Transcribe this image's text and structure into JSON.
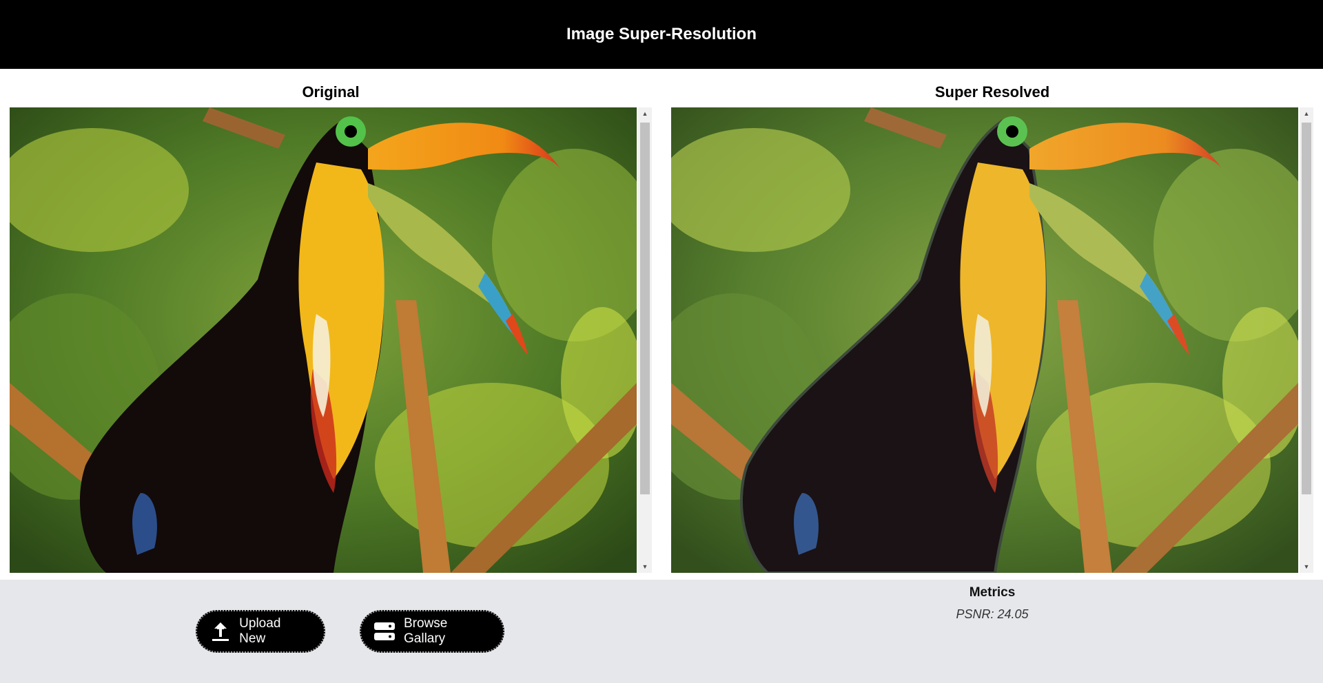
{
  "header": {
    "title": "Image Super-Resolution"
  },
  "panels": {
    "original": {
      "title": "Original"
    },
    "super_resolved": {
      "title": "Super Resolved"
    }
  },
  "actions": {
    "upload_label": "Upload New",
    "upload_icon": "upload-icon",
    "browse_label": "Browse Gallary",
    "browse_icon": "server-icon"
  },
  "metrics": {
    "title": "Metrics",
    "psnr_text": "PSNR: 24.05"
  },
  "colors": {
    "header_bg": "#000000",
    "bottom_bar_bg": "#e5e7eb",
    "button_bg": "#000000"
  }
}
